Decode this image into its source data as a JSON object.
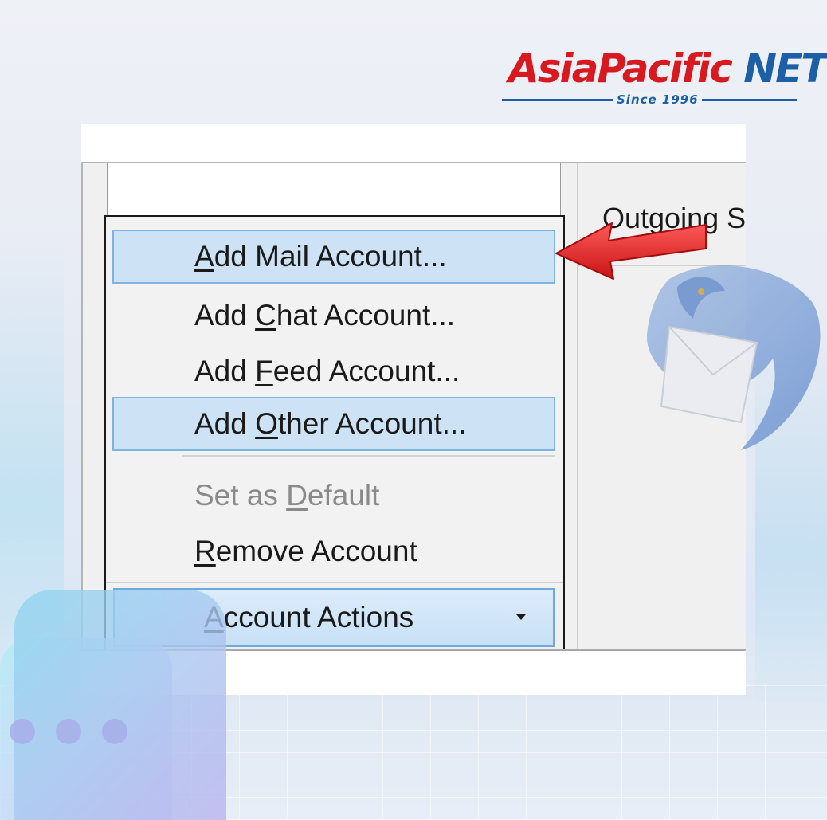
{
  "logo": {
    "brand_part1": "AsiaPacific",
    "brand_part2": "NET",
    "tagline": "Since 1996",
    "colors": {
      "red": "#d8191f",
      "blue": "#1c5fa6"
    }
  },
  "window": {
    "right_panel_label": "Outgoing S"
  },
  "account_menu": {
    "items": [
      {
        "pre": "",
        "key": "A",
        "post": "dd Mail Account...",
        "highlighted": true,
        "enabled": true
      },
      {
        "pre": "Add ",
        "key": "C",
        "post": "hat Account...",
        "highlighted": false,
        "enabled": true
      },
      {
        "pre": "Add ",
        "key": "F",
        "post": "eed Account...",
        "highlighted": false,
        "enabled": true
      },
      {
        "pre": "Add ",
        "key": "O",
        "post": "ther Account...",
        "highlighted": true,
        "enabled": true
      },
      {
        "pre": "Set as ",
        "key": "D",
        "post": "efault",
        "highlighted": false,
        "enabled": false
      },
      {
        "pre": "",
        "key": "R",
        "post": "emove Account",
        "highlighted": false,
        "enabled": true
      }
    ]
  },
  "account_actions_button": {
    "pre": "",
    "key": "A",
    "post": "ccount Actions",
    "icon": "dropdown-caret-icon"
  },
  "decorations": {
    "arrow_icon": "red-pointer-arrow-icon",
    "bird_icon": "thunderbird-logo-icon",
    "bubble_icon": "chat-bubble-icon"
  }
}
